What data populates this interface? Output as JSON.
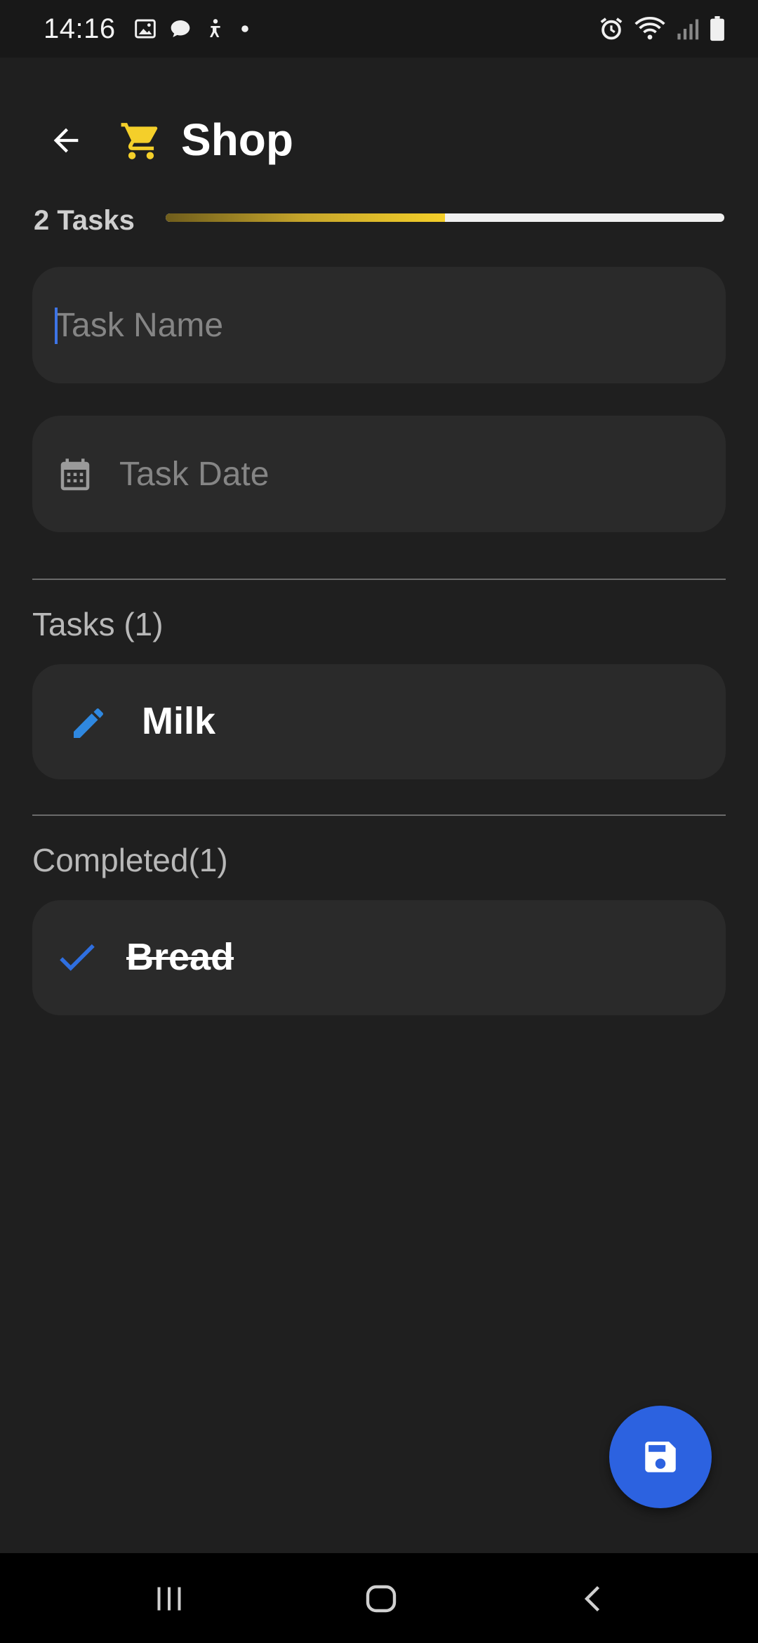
{
  "status_bar": {
    "time": "14:16",
    "left_icons": [
      "image-icon",
      "chat-icon",
      "accessibility-icon",
      "dot-icon"
    ],
    "right_icons": [
      "alarm-icon",
      "wifi-icon",
      "signal-icon",
      "battery-icon"
    ]
  },
  "header": {
    "title": "Shop",
    "back_icon": "arrow-left-icon",
    "list_icon": "shopping-cart-icon",
    "accent_color": "#f4cf2a"
  },
  "progress": {
    "label": "2 Tasks",
    "fraction_complete": 0.5
  },
  "form": {
    "task_name": {
      "value": "",
      "placeholder": "Task Name"
    },
    "task_date": {
      "value": "",
      "placeholder": "Task Date",
      "icon": "calendar-icon"
    }
  },
  "sections": {
    "tasks": {
      "label": "Tasks (1)",
      "items": [
        {
          "label": "Milk",
          "icon": "edit-icon"
        }
      ]
    },
    "completed": {
      "label": "Completed(1)",
      "items": [
        {
          "label": "Bread",
          "icon": "check-icon"
        }
      ]
    }
  },
  "fab": {
    "icon": "save-icon",
    "color": "#2c62e0"
  },
  "nav_bar": {
    "buttons": [
      "recent-apps-icon",
      "home-icon",
      "back-icon"
    ]
  }
}
